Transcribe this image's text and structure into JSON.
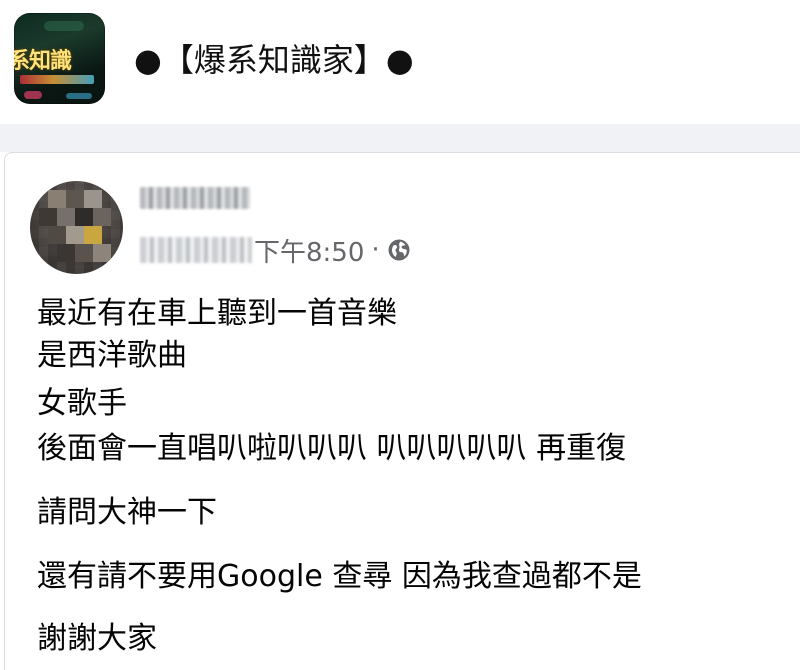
{
  "group": {
    "avatar_text": "系知識",
    "title": "●【爆系知識家】●"
  },
  "post": {
    "author_name": "██ ████",
    "date": "██████",
    "time": "下午8:50",
    "separator": "·",
    "privacy_icon": "globe-icon",
    "lines": [
      "最近有在車上聽到一首音樂",
      "是西洋歌曲",
      "女歌手",
      "後面會一直唱叭啦叭叭叭 叭叭叭叭叭 再重復",
      "請問大神一下",
      "還有請不要用Google 查尋 因為我查過都不是",
      "謝謝大家"
    ]
  },
  "colors": {
    "feed_background": "#f0f2f5",
    "card_background": "#ffffff",
    "text_primary": "#050505",
    "text_secondary": "#65676b"
  }
}
